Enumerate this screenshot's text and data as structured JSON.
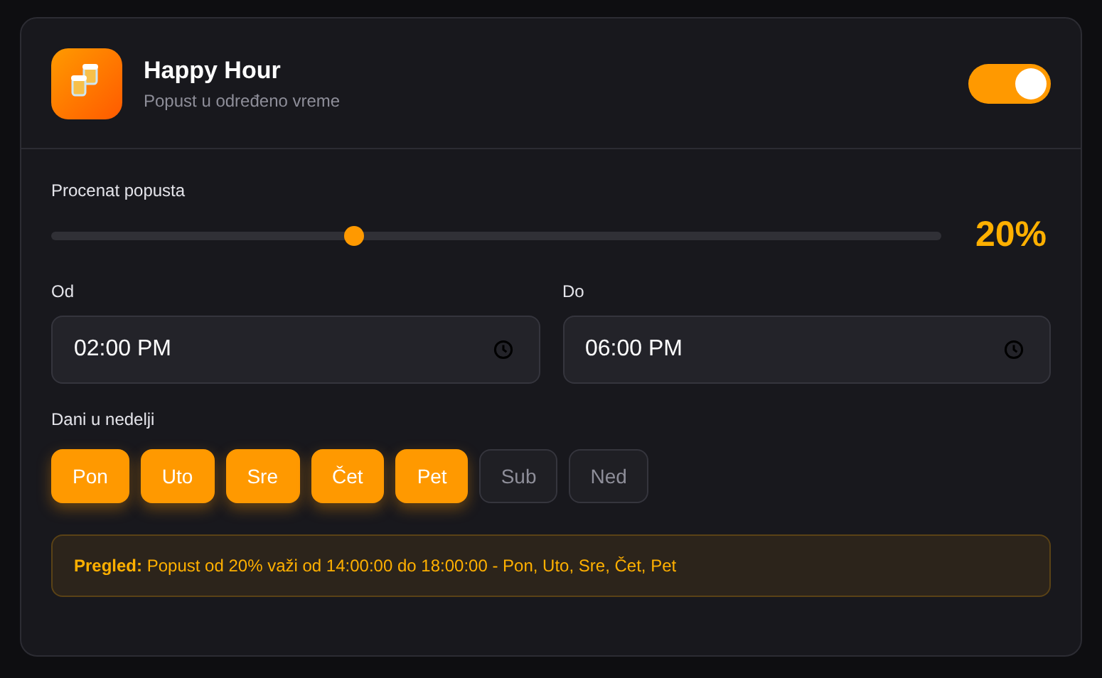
{
  "header": {
    "title": "Happy Hour",
    "subtitle": "Popust u određeno vreme",
    "toggle": {
      "on": true
    }
  },
  "discount": {
    "label": "Procenat popusta",
    "level": 0.34,
    "reading": "20%"
  },
  "times": [
    {
      "label": "Od",
      "value": "02:00 PM"
    },
    {
      "label": "Do",
      "value": "06:00 PM"
    }
  ],
  "days": {
    "label": "Dani u nedelji",
    "items": [
      {
        "label": "Pon",
        "selected": true
      },
      {
        "label": "Uto",
        "selected": true
      },
      {
        "label": "Sre",
        "selected": true
      },
      {
        "label": "Čet",
        "selected": true
      },
      {
        "label": "Pet",
        "selected": true
      },
      {
        "label": "Sub",
        "selected": false
      },
      {
        "label": "Ned",
        "selected": false
      }
    ]
  },
  "preview": "**Pregled:** Popust od 20% važi od 14:00:00 do 18:00:00 - Pon, Uto, Sre, Čet, Pet"
}
